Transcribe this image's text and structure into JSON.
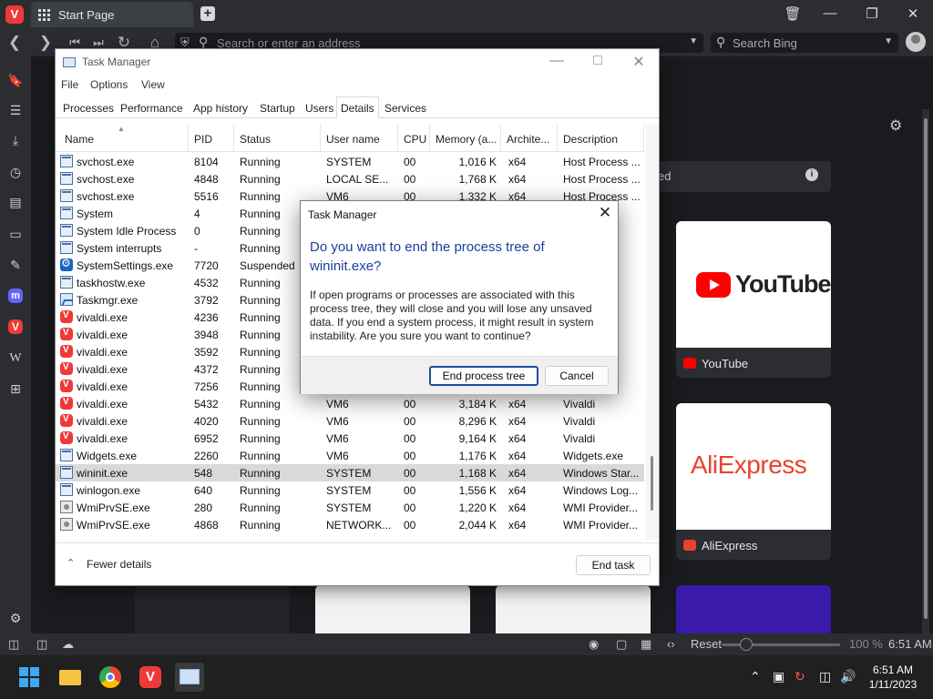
{
  "browser": {
    "tab_title": "Start Page",
    "address_placeholder": "Search or enter an address",
    "search_placeholder": "Search Bing",
    "speed_dial_heading": "ed",
    "speed_dials": [
      {
        "label": "YouTube",
        "logo_text": "YouTube"
      },
      {
        "label": "AliExpress",
        "logo_text": "AliExpress"
      }
    ],
    "status": {
      "reset_label": "Reset",
      "zoom": "100 %",
      "time": "6:51 AM"
    }
  },
  "taskbar": {
    "time": "6:51 AM",
    "date": "1/11/2023"
  },
  "taskmgr": {
    "title": "Task Manager",
    "menu": [
      "File",
      "Options",
      "View"
    ],
    "tabs": [
      "Processes",
      "Performance",
      "App history",
      "Startup",
      "Users",
      "Details",
      "Services"
    ],
    "active_tab": "Details",
    "columns": [
      "Name",
      "PID",
      "Status",
      "User name",
      "CPU",
      "Memory (a...",
      "Archite...",
      "Description"
    ],
    "rows": [
      {
        "icon": "win",
        "name": "svchost.exe",
        "pid": "8104",
        "status": "Running",
        "user": "SYSTEM",
        "cpu": "00",
        "mem": "1,016 K",
        "arch": "x64",
        "desc": "Host Process ..."
      },
      {
        "icon": "win",
        "name": "svchost.exe",
        "pid": "4848",
        "status": "Running",
        "user": "LOCAL SE...",
        "cpu": "00",
        "mem": "1,768 K",
        "arch": "x64",
        "desc": "Host Process ..."
      },
      {
        "icon": "win",
        "name": "svchost.exe",
        "pid": "5516",
        "status": "Running",
        "user": "VM6",
        "cpu": "00",
        "mem": "1,332 K",
        "arch": "x64",
        "desc": "Host Process ..."
      },
      {
        "icon": "win",
        "name": "System",
        "pid": "4",
        "status": "Running",
        "user": "",
        "cpu": "",
        "mem": "",
        "arch": "",
        "desc": ""
      },
      {
        "icon": "win",
        "name": "System Idle Process",
        "pid": "0",
        "status": "Running",
        "user": "",
        "cpu": "",
        "mem": "",
        "arch": "",
        "desc": ""
      },
      {
        "icon": "win",
        "name": "System interrupts",
        "pid": "-",
        "status": "Running",
        "user": "",
        "cpu": "",
        "mem": "",
        "arch": "",
        "desc": ""
      },
      {
        "icon": "gear",
        "name": "SystemSettings.exe",
        "pid": "7720",
        "status": "Suspended",
        "user": "",
        "cpu": "",
        "mem": "",
        "arch": "",
        "desc": ""
      },
      {
        "icon": "win",
        "name": "taskhostw.exe",
        "pid": "4532",
        "status": "Running",
        "user": "",
        "cpu": "",
        "mem": "",
        "arch": "",
        "desc": ""
      },
      {
        "icon": "tmg",
        "name": "Taskmgr.exe",
        "pid": "3792",
        "status": "Running",
        "user": "",
        "cpu": "",
        "mem": "",
        "arch": "",
        "desc": ""
      },
      {
        "icon": "viv",
        "name": "vivaldi.exe",
        "pid": "4236",
        "status": "Running",
        "user": "",
        "cpu": "",
        "mem": "",
        "arch": "",
        "desc": ""
      },
      {
        "icon": "viv",
        "name": "vivaldi.exe",
        "pid": "3948",
        "status": "Running",
        "user": "",
        "cpu": "",
        "mem": "",
        "arch": "",
        "desc": ""
      },
      {
        "icon": "viv",
        "name": "vivaldi.exe",
        "pid": "3592",
        "status": "Running",
        "user": "",
        "cpu": "",
        "mem": "",
        "arch": "",
        "desc": ""
      },
      {
        "icon": "viv",
        "name": "vivaldi.exe",
        "pid": "4372",
        "status": "Running",
        "user": "",
        "cpu": "",
        "mem": "",
        "arch": "",
        "desc": ""
      },
      {
        "icon": "viv",
        "name": "vivaldi.exe",
        "pid": "7256",
        "status": "Running",
        "user": "",
        "cpu": "",
        "mem": "",
        "arch": "",
        "desc": ""
      },
      {
        "icon": "viv",
        "name": "vivaldi.exe",
        "pid": "5432",
        "status": "Running",
        "user": "VM6",
        "cpu": "00",
        "mem": "3,184 K",
        "arch": "x64",
        "desc": "Vivaldi"
      },
      {
        "icon": "viv",
        "name": "vivaldi.exe",
        "pid": "4020",
        "status": "Running",
        "user": "VM6",
        "cpu": "00",
        "mem": "8,296 K",
        "arch": "x64",
        "desc": "Vivaldi"
      },
      {
        "icon": "viv",
        "name": "vivaldi.exe",
        "pid": "6952",
        "status": "Running",
        "user": "VM6",
        "cpu": "00",
        "mem": "9,164 K",
        "arch": "x64",
        "desc": "Vivaldi"
      },
      {
        "icon": "win",
        "name": "Widgets.exe",
        "pid": "2260",
        "status": "Running",
        "user": "VM6",
        "cpu": "00",
        "mem": "1,176 K",
        "arch": "x64",
        "desc": "Widgets.exe"
      },
      {
        "icon": "win",
        "name": "wininit.exe",
        "pid": "548",
        "status": "Running",
        "user": "SYSTEM",
        "cpu": "00",
        "mem": "1,168 K",
        "arch": "x64",
        "desc": "Windows Star...",
        "selected": true
      },
      {
        "icon": "win",
        "name": "winlogon.exe",
        "pid": "640",
        "status": "Running",
        "user": "SYSTEM",
        "cpu": "00",
        "mem": "1,556 K",
        "arch": "x64",
        "desc": "Windows Log..."
      },
      {
        "icon": "wmi",
        "name": "WmiPrvSE.exe",
        "pid": "280",
        "status": "Running",
        "user": "SYSTEM",
        "cpu": "00",
        "mem": "1,220 K",
        "arch": "x64",
        "desc": "WMI Provider..."
      },
      {
        "icon": "wmi",
        "name": "WmiPrvSE.exe",
        "pid": "4868",
        "status": "Running",
        "user": "NETWORK...",
        "cpu": "00",
        "mem": "2,044 K",
        "arch": "x64",
        "desc": "WMI Provider..."
      }
    ],
    "fewer_details_label": "Fewer details",
    "end_task_label": "End task"
  },
  "dialog": {
    "title": "Task Manager",
    "heading": "Do you want to end the process tree of wininit.exe?",
    "message": "If open programs or processes are associated with this process tree, they will close and you will lose any unsaved data. If you end a system process, it might result in system instability. Are you sure you want to continue?",
    "confirm_label": "End process tree",
    "cancel_label": "Cancel"
  }
}
